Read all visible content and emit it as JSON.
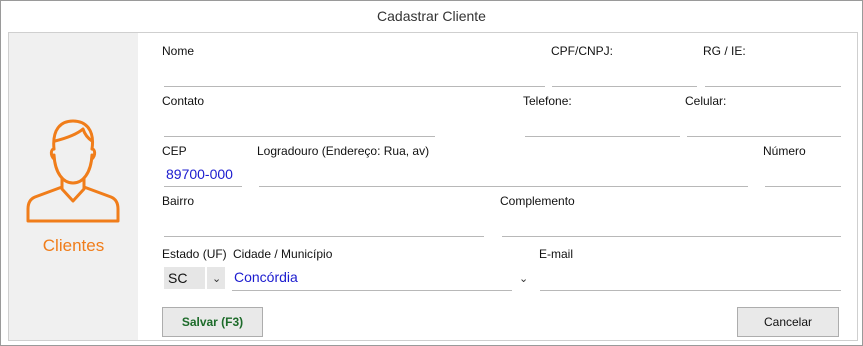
{
  "window": {
    "title": "Cadastrar Cliente"
  },
  "sidebar": {
    "caption": "Clientes",
    "icon": "user-icon",
    "accent": "#f07d1a"
  },
  "form": {
    "nome_label": "Nome",
    "cpf_label": "CPF/CNPJ:",
    "rg_label": "RG / IE:",
    "contato_label": "Contato",
    "telefone_label": "Telefone:",
    "celular_label": "Celular:",
    "cep_label": "CEP",
    "cep_value": "89700-000",
    "logradouro_label": "Logradouro (Endereço: Rua, av)",
    "numero_label": "Número",
    "bairro_label": "Bairro",
    "complemento_label": "Complemento",
    "estado_label": "Estado (UF)",
    "cidade_label": "Cidade / Município",
    "email_label": "E-mail",
    "estado_value": "SC",
    "cidade_value": "Concórdia",
    "value_color": "#1c1ccf"
  },
  "buttons": {
    "save": "Salvar (F3)",
    "cancel": "Cancelar"
  }
}
